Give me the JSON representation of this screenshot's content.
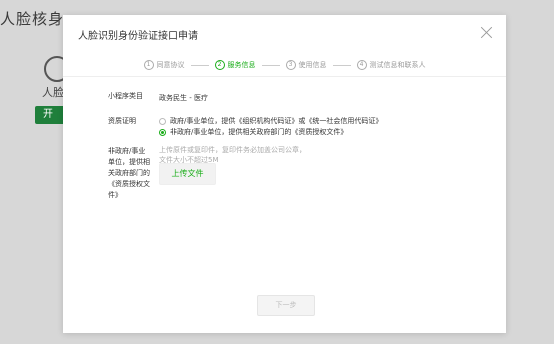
{
  "background": {
    "title": "人脸核身",
    "card_label": "人脸核",
    "card_button": "开"
  },
  "modal": {
    "title": "人脸识别身份验证接口申请",
    "steps": [
      {
        "num": "1",
        "label": "同意协议"
      },
      {
        "num": "2",
        "label": "服务信息"
      },
      {
        "num": "3",
        "label": "使用信息"
      },
      {
        "num": "4",
        "label": "测试信息和联系人"
      }
    ],
    "category_label": "小程序类目",
    "category_value": "政务民生 - 医疗",
    "qualification_label": "资质证明",
    "options": [
      "政府/事业单位，提供《组织机构代码证》或《统一社会信用代码证》",
      "非政府/事业单位，提供相关政府部门的《资质授权文件》"
    ],
    "doc_label": "非政府/事业单位，提供相关政府部门的《资质授权文件》",
    "upload_hint": "上传原件或复印件，复印件务必加盖公司公章，文件大小不超过5M",
    "upload_button": "上传文件",
    "next_button": "下一步"
  }
}
